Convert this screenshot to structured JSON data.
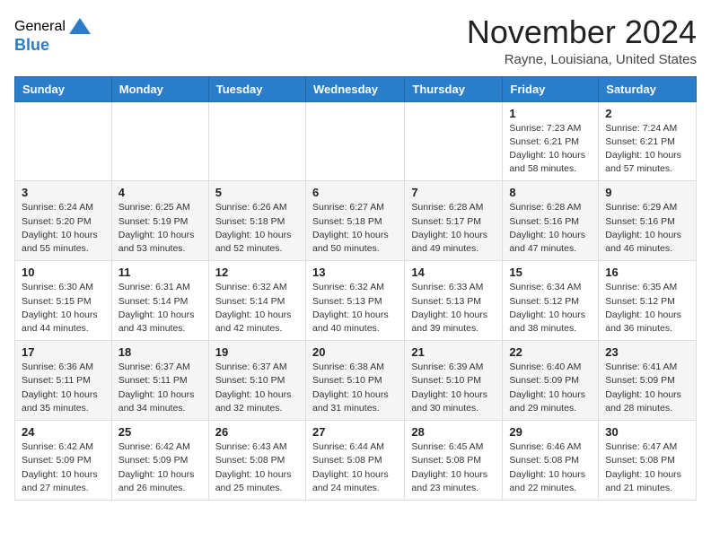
{
  "header": {
    "logo_general": "General",
    "logo_blue": "Blue",
    "month": "November 2024",
    "location": "Rayne, Louisiana, United States"
  },
  "weekdays": [
    "Sunday",
    "Monday",
    "Tuesday",
    "Wednesday",
    "Thursday",
    "Friday",
    "Saturday"
  ],
  "weeks": [
    [
      {
        "day": "",
        "info": ""
      },
      {
        "day": "",
        "info": ""
      },
      {
        "day": "",
        "info": ""
      },
      {
        "day": "",
        "info": ""
      },
      {
        "day": "",
        "info": ""
      },
      {
        "day": "1",
        "info": "Sunrise: 7:23 AM\nSunset: 6:21 PM\nDaylight: 10 hours\nand 58 minutes."
      },
      {
        "day": "2",
        "info": "Sunrise: 7:24 AM\nSunset: 6:21 PM\nDaylight: 10 hours\nand 57 minutes."
      }
    ],
    [
      {
        "day": "3",
        "info": "Sunrise: 6:24 AM\nSunset: 5:20 PM\nDaylight: 10 hours\nand 55 minutes."
      },
      {
        "day": "4",
        "info": "Sunrise: 6:25 AM\nSunset: 5:19 PM\nDaylight: 10 hours\nand 53 minutes."
      },
      {
        "day": "5",
        "info": "Sunrise: 6:26 AM\nSunset: 5:18 PM\nDaylight: 10 hours\nand 52 minutes."
      },
      {
        "day": "6",
        "info": "Sunrise: 6:27 AM\nSunset: 5:18 PM\nDaylight: 10 hours\nand 50 minutes."
      },
      {
        "day": "7",
        "info": "Sunrise: 6:28 AM\nSunset: 5:17 PM\nDaylight: 10 hours\nand 49 minutes."
      },
      {
        "day": "8",
        "info": "Sunrise: 6:28 AM\nSunset: 5:16 PM\nDaylight: 10 hours\nand 47 minutes."
      },
      {
        "day": "9",
        "info": "Sunrise: 6:29 AM\nSunset: 5:16 PM\nDaylight: 10 hours\nand 46 minutes."
      }
    ],
    [
      {
        "day": "10",
        "info": "Sunrise: 6:30 AM\nSunset: 5:15 PM\nDaylight: 10 hours\nand 44 minutes."
      },
      {
        "day": "11",
        "info": "Sunrise: 6:31 AM\nSunset: 5:14 PM\nDaylight: 10 hours\nand 43 minutes."
      },
      {
        "day": "12",
        "info": "Sunrise: 6:32 AM\nSunset: 5:14 PM\nDaylight: 10 hours\nand 42 minutes."
      },
      {
        "day": "13",
        "info": "Sunrise: 6:32 AM\nSunset: 5:13 PM\nDaylight: 10 hours\nand 40 minutes."
      },
      {
        "day": "14",
        "info": "Sunrise: 6:33 AM\nSunset: 5:13 PM\nDaylight: 10 hours\nand 39 minutes."
      },
      {
        "day": "15",
        "info": "Sunrise: 6:34 AM\nSunset: 5:12 PM\nDaylight: 10 hours\nand 38 minutes."
      },
      {
        "day": "16",
        "info": "Sunrise: 6:35 AM\nSunset: 5:12 PM\nDaylight: 10 hours\nand 36 minutes."
      }
    ],
    [
      {
        "day": "17",
        "info": "Sunrise: 6:36 AM\nSunset: 5:11 PM\nDaylight: 10 hours\nand 35 minutes."
      },
      {
        "day": "18",
        "info": "Sunrise: 6:37 AM\nSunset: 5:11 PM\nDaylight: 10 hours\nand 34 minutes."
      },
      {
        "day": "19",
        "info": "Sunrise: 6:37 AM\nSunset: 5:10 PM\nDaylight: 10 hours\nand 32 minutes."
      },
      {
        "day": "20",
        "info": "Sunrise: 6:38 AM\nSunset: 5:10 PM\nDaylight: 10 hours\nand 31 minutes."
      },
      {
        "day": "21",
        "info": "Sunrise: 6:39 AM\nSunset: 5:10 PM\nDaylight: 10 hours\nand 30 minutes."
      },
      {
        "day": "22",
        "info": "Sunrise: 6:40 AM\nSunset: 5:09 PM\nDaylight: 10 hours\nand 29 minutes."
      },
      {
        "day": "23",
        "info": "Sunrise: 6:41 AM\nSunset: 5:09 PM\nDaylight: 10 hours\nand 28 minutes."
      }
    ],
    [
      {
        "day": "24",
        "info": "Sunrise: 6:42 AM\nSunset: 5:09 PM\nDaylight: 10 hours\nand 27 minutes."
      },
      {
        "day": "25",
        "info": "Sunrise: 6:42 AM\nSunset: 5:09 PM\nDaylight: 10 hours\nand 26 minutes."
      },
      {
        "day": "26",
        "info": "Sunrise: 6:43 AM\nSunset: 5:08 PM\nDaylight: 10 hours\nand 25 minutes."
      },
      {
        "day": "27",
        "info": "Sunrise: 6:44 AM\nSunset: 5:08 PM\nDaylight: 10 hours\nand 24 minutes."
      },
      {
        "day": "28",
        "info": "Sunrise: 6:45 AM\nSunset: 5:08 PM\nDaylight: 10 hours\nand 23 minutes."
      },
      {
        "day": "29",
        "info": "Sunrise: 6:46 AM\nSunset: 5:08 PM\nDaylight: 10 hours\nand 22 minutes."
      },
      {
        "day": "30",
        "info": "Sunrise: 6:47 AM\nSunset: 5:08 PM\nDaylight: 10 hours\nand 21 minutes."
      }
    ]
  ]
}
